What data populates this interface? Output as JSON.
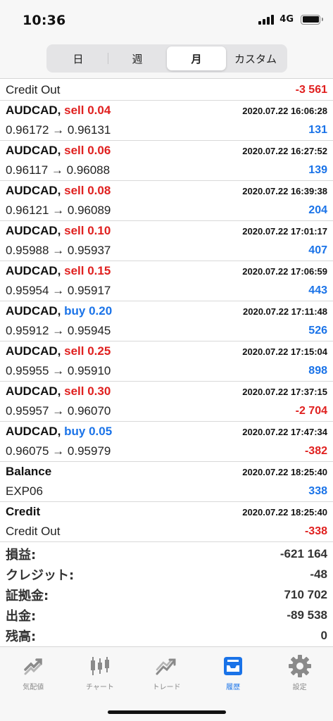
{
  "status": {
    "time": "10:36",
    "network": "4G"
  },
  "period_tabs": [
    "日",
    "週",
    "月",
    "カスタム"
  ],
  "credit_out_top": {
    "label": "Credit Out",
    "value": "-3 561"
  },
  "trades": [
    {
      "symbol": "AUDCAD,",
      "side": "sell 0.04",
      "time": "2020.07.22 16:06:28",
      "prices": "0.96172 → 0.96131",
      "pnl": "131"
    },
    {
      "symbol": "AUDCAD,",
      "side": "sell 0.06",
      "time": "2020.07.22 16:27:52",
      "prices": "0.96117 → 0.96088",
      "pnl": "139"
    },
    {
      "symbol": "AUDCAD,",
      "side": "sell 0.08",
      "time": "2020.07.22 16:39:38",
      "prices": "0.96121 → 0.96089",
      "pnl": "204"
    },
    {
      "symbol": "AUDCAD,",
      "side": "sell 0.10",
      "time": "2020.07.22 17:01:17",
      "prices": "0.95988 → 0.95937",
      "pnl": "407"
    },
    {
      "symbol": "AUDCAD,",
      "side": "sell 0.15",
      "time": "2020.07.22 17:06:59",
      "prices": "0.95954 → 0.95917",
      "pnl": "443"
    },
    {
      "symbol": "AUDCAD,",
      "side": "buy 0.20",
      "time": "2020.07.22 17:11:48",
      "prices": "0.95912 → 0.95945",
      "pnl": "526"
    },
    {
      "symbol": "AUDCAD,",
      "side": "sell 0.25",
      "time": "2020.07.22 17:15:04",
      "prices": "0.95955 → 0.95910",
      "pnl": "898"
    },
    {
      "symbol": "AUDCAD,",
      "side": "sell 0.30",
      "time": "2020.07.22 17:37:15",
      "prices": "0.95957 → 0.96070",
      "pnl": "-2 704"
    },
    {
      "symbol": "AUDCAD,",
      "side": "buy 0.05",
      "time": "2020.07.22 17:47:34",
      "prices": "0.96075 → 0.95979",
      "pnl": "-382"
    }
  ],
  "balance_entry": {
    "type": "Balance",
    "time": "2020.07.22 18:25:40",
    "comment": "EXP06",
    "value": "338"
  },
  "credit_entry": {
    "type": "Credit",
    "time": "2020.07.22 18:25:40",
    "comment": "Credit Out",
    "value": "-338"
  },
  "summary": [
    {
      "label": "損益:",
      "value": "-621 164"
    },
    {
      "label": "クレジット:",
      "value": "-48"
    },
    {
      "label": "証拠金:",
      "value": "710 702"
    },
    {
      "label": "出金:",
      "value": "-89 538"
    },
    {
      "label": "残高:",
      "value": "0"
    }
  ],
  "tabbar": [
    {
      "label": "気配値",
      "icon": "quotes-icon"
    },
    {
      "label": "チャート",
      "icon": "chart-icon"
    },
    {
      "label": "トレード",
      "icon": "trade-icon"
    },
    {
      "label": "履歴",
      "icon": "history-icon",
      "active": true
    },
    {
      "label": "設定",
      "icon": "settings-icon"
    }
  ],
  "colors": {
    "positive": "#1a73e8",
    "negative": "#e0201f",
    "inactive_tab": "#8a8a8a"
  }
}
